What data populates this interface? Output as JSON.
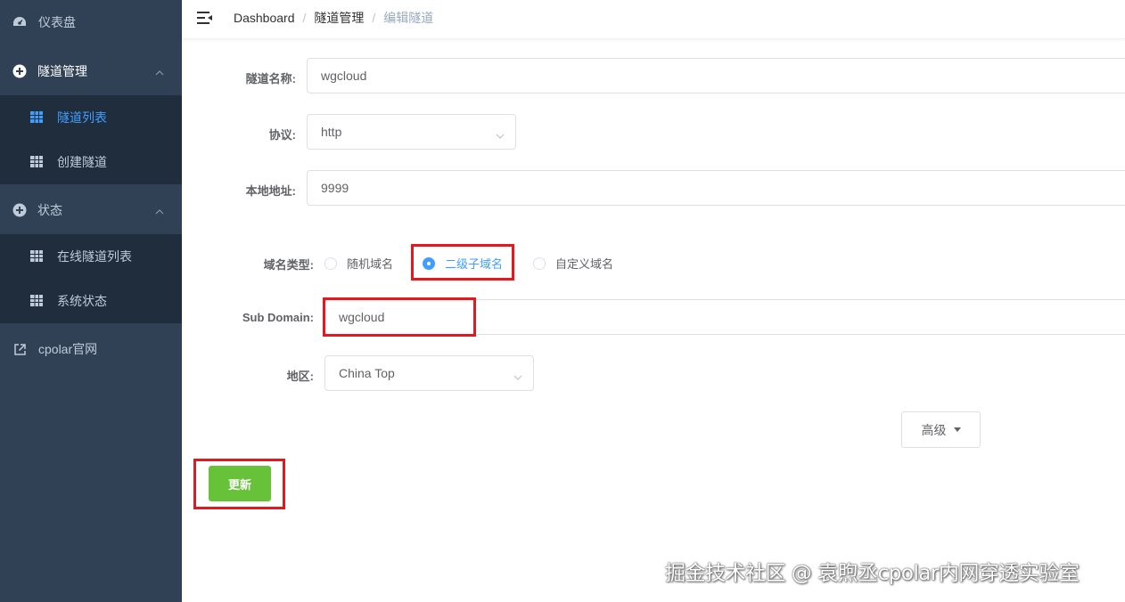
{
  "sidebar": {
    "items": [
      {
        "label": "仪表盘",
        "icon": "dashboard-icon"
      },
      {
        "label": "隧道管理",
        "icon": "plus-circle-icon",
        "expanded": true,
        "children": [
          {
            "label": "隧道列表",
            "icon": "grid-icon",
            "active": true
          },
          {
            "label": "创建隧道",
            "icon": "grid-icon"
          }
        ]
      },
      {
        "label": "状态",
        "icon": "plus-circle-icon",
        "expanded": true,
        "children": [
          {
            "label": "在线隧道列表",
            "icon": "grid-icon"
          },
          {
            "label": "系统状态",
            "icon": "grid-icon"
          }
        ]
      },
      {
        "label": "cpolar官网",
        "icon": "external-link-icon"
      }
    ]
  },
  "header": {
    "breadcrumb": [
      "Dashboard",
      "隧道管理",
      "编辑隧道"
    ],
    "separator": "/"
  },
  "form": {
    "tunnel_name": {
      "label": "隧道名称:",
      "value": "wgcloud"
    },
    "protocol": {
      "label": "协议:",
      "value": "http"
    },
    "local_address": {
      "label": "本地地址:",
      "value": "9999"
    },
    "domain_type": {
      "label": "域名类型:",
      "options": [
        "随机域名",
        "二级子域名",
        "自定义域名"
      ],
      "selected": "二级子域名"
    },
    "sub_domain": {
      "label": "Sub Domain:",
      "value": "wgcloud"
    },
    "region": {
      "label": "地区:",
      "value": "China Top"
    },
    "advanced_label": "高级",
    "update_label": "更新"
  },
  "watermark": "掘金技术社区 @ 袁煦丞cpolar内网穿透实验室",
  "colors": {
    "sidebar_bg": "#304156",
    "submenu_bg": "#1f2d3d",
    "accent": "#409eff",
    "success": "#67c23a",
    "highlight": "#e5191d"
  }
}
